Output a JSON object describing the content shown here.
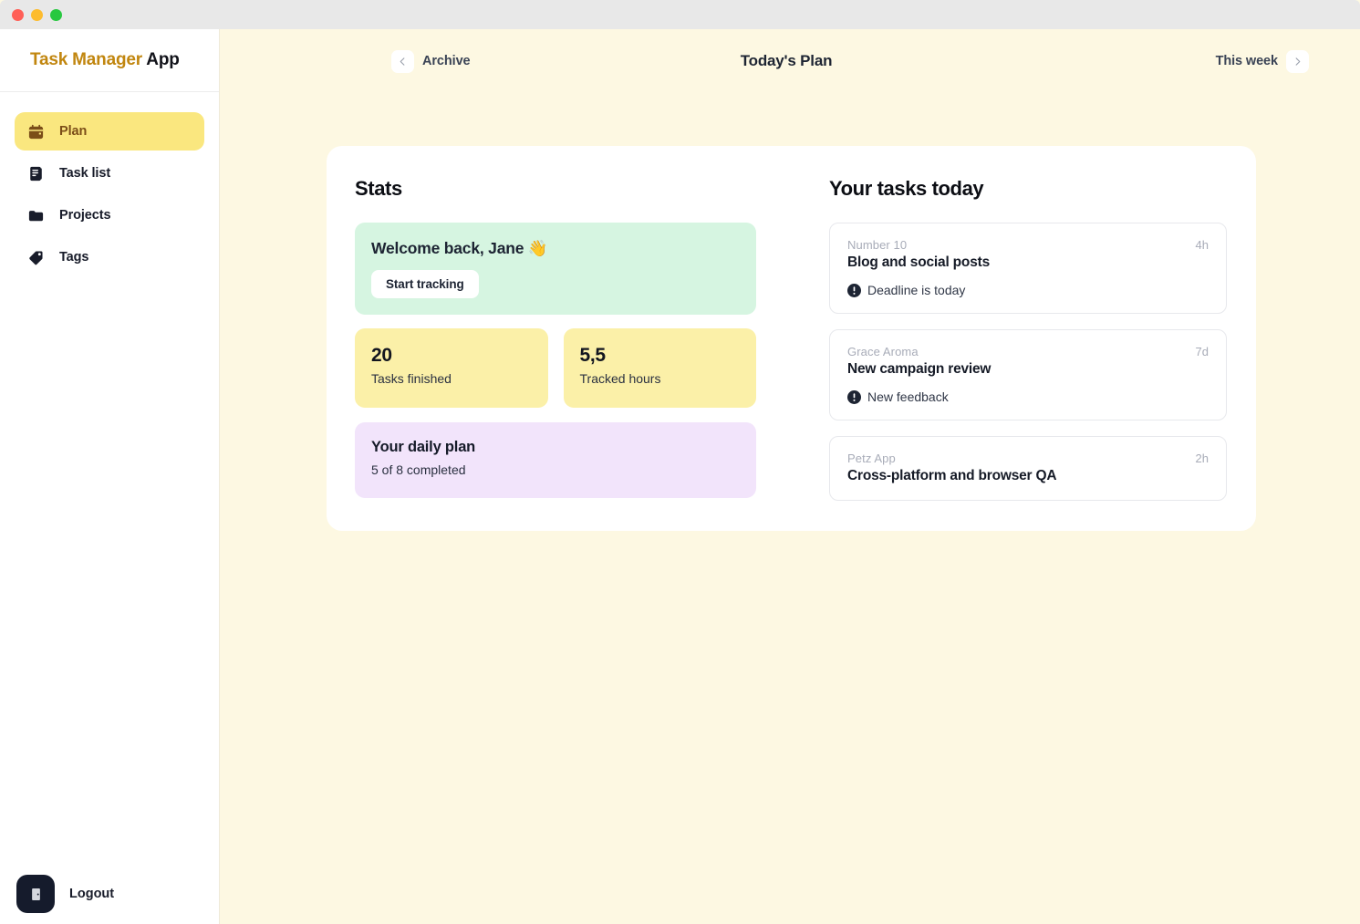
{
  "window": {
    "traffic_lights": [
      {
        "name": "close",
        "color": "#FF5F57"
      },
      {
        "name": "minimize",
        "color": "#FDBC2E"
      },
      {
        "name": "maximize",
        "color": "#28C840"
      }
    ]
  },
  "theme": {
    "page_background": "#FDF8E2",
    "sidebar_background": "#FFFFFF",
    "card_background": "#FFFFFF",
    "accent_yellow": "#FAE77F",
    "accent_brown": "#7B4E18",
    "logo_accent": "#C1860F",
    "mint": "#D6F5E1",
    "stat_yellow": "#FBF0A8",
    "lavender": "#F2E4FB",
    "dark": "#151B2C"
  },
  "sidebar": {
    "logo": {
      "accent_text": "Task Manager",
      "plain_text": "App"
    },
    "items": [
      {
        "label": "Plan",
        "icon": "calendar-icon",
        "active": true
      },
      {
        "label": "Task list",
        "icon": "list-document-icon",
        "active": false
      },
      {
        "label": "Projects",
        "icon": "folder-icon",
        "active": false
      },
      {
        "label": "Tags",
        "icon": "tag-icon",
        "active": false
      }
    ],
    "logout": {
      "label": "Logout",
      "icon": "exit-door-icon"
    }
  },
  "topbar": {
    "back_icon": "chevron-left-icon",
    "back_label": "Archive",
    "title": "Today's Plan",
    "forward_label": "This week",
    "forward_icon": "chevron-right-icon"
  },
  "stats": {
    "title": "Stats",
    "welcome": {
      "greeting": "Welcome back, Jane 👋",
      "button_label": "Start tracking"
    },
    "cards": [
      {
        "value": "20",
        "label": "Tasks finished"
      },
      {
        "value": "5,5",
        "label": "Tracked hours"
      }
    ],
    "daily_plan": {
      "title": "Your daily plan",
      "subtitle": "5 of 8 completed"
    }
  },
  "tasks": {
    "title": "Your tasks today",
    "items": [
      {
        "project": "Number 10",
        "title": "Blog and social posts",
        "duration": "4h",
        "badge": "Deadline is today",
        "badge_icon": "alert-circle-icon"
      },
      {
        "project": "Grace Aroma",
        "title": "New campaign review",
        "duration": "7d",
        "badge": "New feedback",
        "badge_icon": "alert-circle-icon"
      },
      {
        "project": "Petz App",
        "title": "Cross-platform and browser QA",
        "duration": "2h",
        "badge": null,
        "badge_icon": null
      }
    ]
  }
}
